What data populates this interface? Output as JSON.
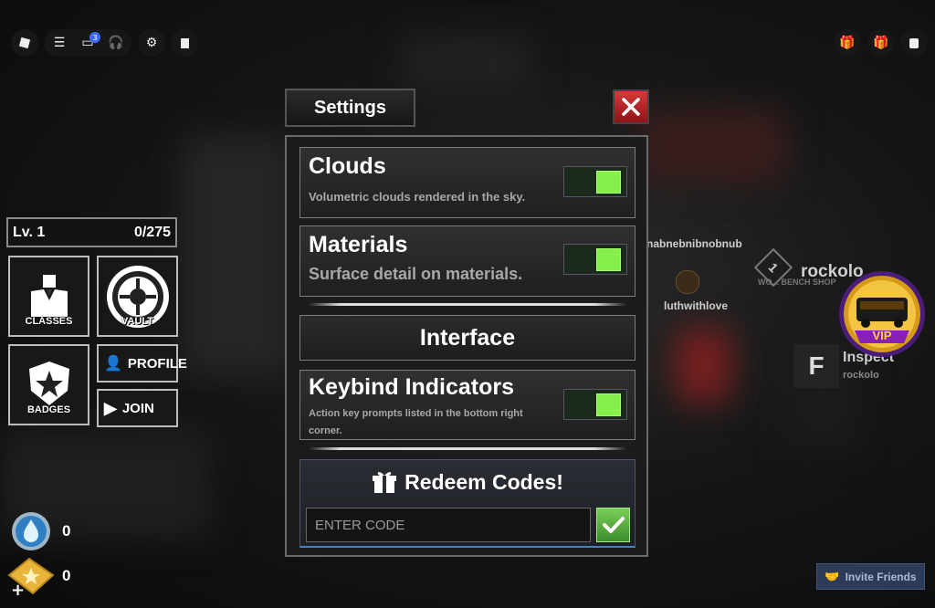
{
  "topbar": {
    "menu_badge": "3"
  },
  "hud": {
    "level": "Lv. 1",
    "xp": "0/275",
    "tiles": {
      "classes": "CLASSES",
      "vault": "VAULT",
      "badges": "BADGES",
      "profile": "PROFILE",
      "join": "JOIN"
    },
    "currency": [
      {
        "icon": "water-coin-icon",
        "value": "0"
      },
      {
        "icon": "ticket-icon",
        "value": "0"
      }
    ]
  },
  "settings": {
    "title": "Settings",
    "options": [
      {
        "title": "Clouds",
        "description": "Volumetric clouds rendered in the sky.",
        "enabled": true
      },
      {
        "title": "Materials",
        "description": "Surface detail on materials.",
        "enabled": true
      }
    ],
    "interface_section": "Interface",
    "interface_options": [
      {
        "title": "Keybind Indicators",
        "description": "Action key prompts listed in the bottom right corner.",
        "enabled": true
      }
    ],
    "redeem": {
      "title": "Redeem Codes!",
      "placeholder": "ENTER CODE"
    }
  },
  "world": {
    "player_names": [
      "nabnebnibnobnub",
      "rockolo",
      "luthwithlove"
    ],
    "rank_number": "1",
    "shop_sign": "WO... BENCH SHOP",
    "inspect_key": "F",
    "inspect_label": "Inspect",
    "inspect_target": "rockolo",
    "vip_label": "VIP"
  },
  "invite": {
    "label": "Invite Friends"
  },
  "colors": {
    "toggle_on": "#86f04a",
    "close_red": "#c0262a",
    "confirm_green": "#5cb33e",
    "accent_blue": "#3a86d1"
  }
}
